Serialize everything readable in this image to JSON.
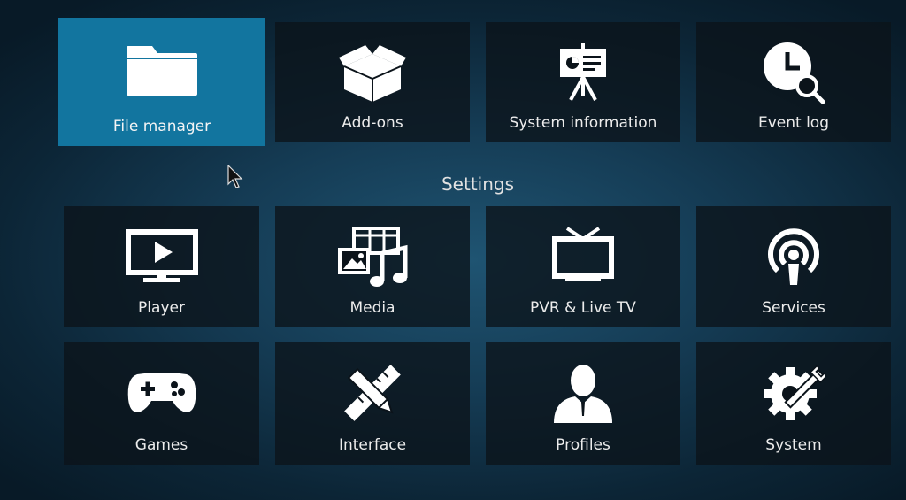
{
  "top_row": [
    {
      "label": "File manager",
      "icon": "folder-icon"
    },
    {
      "label": "Add-ons",
      "icon": "open-box-icon"
    },
    {
      "label": "System information",
      "icon": "presentation-easel-icon"
    },
    {
      "label": "Event log",
      "icon": "clock-search-icon"
    }
  ],
  "settings": {
    "title": "Settings",
    "row1": [
      {
        "label": "Player",
        "icon": "tv-play-icon"
      },
      {
        "label": "Media",
        "icon": "media-photo-film-music-icon"
      },
      {
        "label": "PVR & Live TV",
        "icon": "tv-antenna-icon"
      },
      {
        "label": "Services",
        "icon": "broadcast-signal-icon"
      }
    ],
    "row2": [
      {
        "label": "Games",
        "icon": "gamepad-icon"
      },
      {
        "label": "Interface",
        "icon": "pencil-ruler-icon"
      },
      {
        "label": "Profiles",
        "icon": "user-silhouette-icon"
      },
      {
        "label": "System",
        "icon": "gear-wrench-icon"
      }
    ]
  },
  "focused_item": "File manager",
  "colors": {
    "focus": "#12759f",
    "tile": "#0b131a",
    "text": "#ececec"
  }
}
